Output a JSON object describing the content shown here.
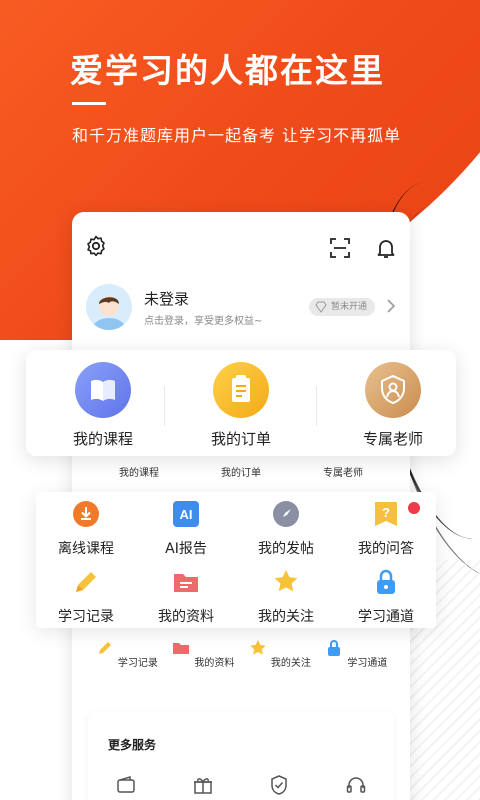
{
  "hero": {
    "headline": "爱学习的人都在这里",
    "subline": "和千万准题库用户一起备考 让学习不再孤单"
  },
  "profile": {
    "title": "未登录",
    "subtitle": "点击登录，享受更多权益~",
    "vip_badge": "暂未开通"
  },
  "main_tiles": [
    {
      "label": "我的课程",
      "icon": "book-icon",
      "color": "#6f86f2"
    },
    {
      "label": "我的订单",
      "icon": "clipboard-icon",
      "color": "#f7b923"
    },
    {
      "label": "专属老师",
      "icon": "teacher-icon",
      "color": "#d9a66d"
    }
  ],
  "small_tiles": [
    "我的课程",
    "我的订单",
    "专属老师"
  ],
  "tools_row1": [
    {
      "label": "离线课程",
      "icon": "download-icon",
      "color": "#f07a2a"
    },
    {
      "label": "AI报告",
      "icon": "ai-icon",
      "color": "#3f8cf0"
    },
    {
      "label": "我的发帖",
      "icon": "compass-icon",
      "color": "#8a8fa3"
    },
    {
      "label": "我的问答",
      "icon": "question-icon",
      "color": "#f5c042"
    }
  ],
  "tools_row2": [
    {
      "label": "学习记录",
      "icon": "pencil-icon",
      "color": "#f6c23a"
    },
    {
      "label": "我的资料",
      "icon": "folder-icon",
      "color": "#ef6a6a"
    },
    {
      "label": "我的关注",
      "icon": "star-icon",
      "color": "#f6c23a"
    },
    {
      "label": "学习通道",
      "icon": "lock-icon",
      "color": "#3f9cf5"
    }
  ],
  "mini_tools": [
    "学习记录",
    "我的资料",
    "我的关注",
    "学习通道"
  ],
  "more_services": {
    "title": "更多服务",
    "icons": [
      "wallet-icon",
      "gift-icon",
      "shield-icon",
      "headset-icon"
    ]
  },
  "colors": {
    "brand": "#ef4a19",
    "notification": "#ec3b4b"
  }
}
